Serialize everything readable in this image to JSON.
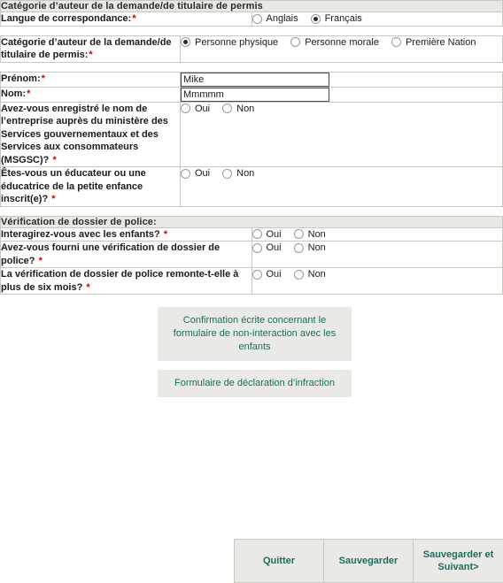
{
  "sections": {
    "applicant": {
      "header": "Catégorie d’auteur de la demande/de titulaire de permis",
      "language_label": "Langue de correspondance:",
      "language_options": [
        {
          "label": "Anglais",
          "checked": false
        },
        {
          "label": "Français",
          "checked": true
        }
      ]
    },
    "category": {
      "label": "Catégorie d’auteur de la demande/de titulaire de permis:",
      "options": [
        {
          "label": "Personne physique",
          "checked": true
        },
        {
          "label": "Personne morale",
          "checked": false
        },
        {
          "label": "Première Nation",
          "checked": false
        }
      ]
    },
    "identity": {
      "first_name_label": "Prénom:",
      "first_name_value": "Mike",
      "last_name_label": "Nom:",
      "last_name_value": "Mmmmm",
      "msgsc_label": "Avez-vous enregistré le nom de l’entreprise auprès du ministère des Services gouvernementaux et des Services aux consommateurs (MSGSC)?",
      "msgsc_options": [
        {
          "label": "Oui",
          "checked": false
        },
        {
          "label": "Non",
          "checked": false
        }
      ],
      "educator_label": "Êtes-vous un éducateur ou une éducatrice de la petite enfance inscrit(e)?",
      "educator_options": [
        {
          "label": "Oui",
          "checked": false
        },
        {
          "label": "Non",
          "checked": false
        }
      ]
    },
    "police": {
      "header": "Vérification de dossier de police:",
      "interact_label": "Interagirez-vous avec les enfants?",
      "interact_options": [
        {
          "label": "Oui",
          "checked": false
        },
        {
          "label": "Non",
          "checked": false
        }
      ],
      "provided_label": "Avez-vous fourni une vérification de dossier de police?",
      "provided_options": [
        {
          "label": "Oui",
          "checked": false
        },
        {
          "label": "Non",
          "checked": false
        }
      ],
      "older_label": "La vérification de dossier de police remonte-t-elle à plus de six mois?",
      "older_options": [
        {
          "label": "Oui",
          "checked": false
        },
        {
          "label": "Non",
          "checked": false
        }
      ]
    }
  },
  "documents": {
    "confirmation_label": "Confirmation écrite concernant le formulaire de non-interaction avec les enfants",
    "infraction_label": "Formulaire de déclaration d’infraction"
  },
  "nav": {
    "quit_label": "Quitter",
    "save_label": "Sauvegarder",
    "save_next_label": "Sauvegarder et Suivant>"
  },
  "required_marker": "*",
  "colors": {
    "section_header_bg": "#e8e8e4",
    "link_text": "#1f6b5c",
    "required": "#cc0000",
    "border": "#c9c9c4"
  }
}
